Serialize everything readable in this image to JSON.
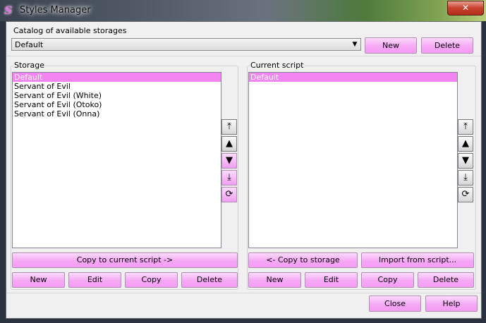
{
  "window": {
    "title": "Styles Manager",
    "icon_letter": "S",
    "close_glyph": "✕"
  },
  "catalog": {
    "label": "Catalog of available storages",
    "selected": "Default",
    "new_label": "New",
    "delete_label": "Delete"
  },
  "storage": {
    "label": "Storage",
    "items": [
      {
        "text": "Default",
        "selected": true
      },
      {
        "text": "Servant of Evil",
        "selected": false
      },
      {
        "text": "Servant of Evil (White)",
        "selected": false
      },
      {
        "text": "Servant of Evil (Otoko)",
        "selected": false
      },
      {
        "text": "Servant of Evil (Onna)",
        "selected": false
      }
    ],
    "copy_label": "Copy to current script ->",
    "new_label": "New",
    "edit_label": "Edit",
    "copy_btn_label": "Copy",
    "delete_label": "Delete",
    "side_icons": [
      "move-top-icon",
      "move-up-icon",
      "move-down-icon",
      "move-bottom-icon",
      "sort-icon"
    ]
  },
  "script": {
    "label": "Current script",
    "items": [
      {
        "text": "Default",
        "selected": true
      }
    ],
    "copy_label": "<- Copy to storage",
    "import_label": "Import from script...",
    "new_label": "New",
    "edit_label": "Edit",
    "copy_btn_label": "Copy",
    "delete_label": "Delete",
    "side_icons": [
      "move-top-icon",
      "move-up-icon",
      "move-down-icon",
      "move-bottom-icon",
      "sort-icon"
    ]
  },
  "footer": {
    "close_label": "Close",
    "help_label": "Help"
  },
  "colors": {
    "button_pink": "#f6a8f6",
    "selection": "#f285f2"
  }
}
